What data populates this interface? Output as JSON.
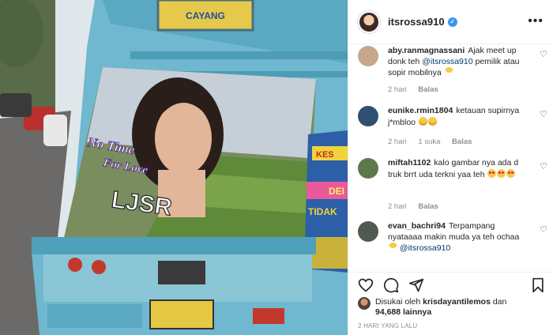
{
  "post": {
    "username": "itsrossa910",
    "verified_glyph": "✓",
    "more_glyph": "•••"
  },
  "image_text": {
    "plate_top": "CAYANG",
    "sticker_line1": "No Time",
    "sticker_line2": "For Love",
    "sticker_name": "LJSR",
    "side_sign1": "KES",
    "side_sign2": "DEI",
    "side_sign3": "TIDAK"
  },
  "comments": [
    {
      "user": "aby.ranmagnassani",
      "text_before": "Ajak meet up donk teh ",
      "mention": "@itsrossa910",
      "text_after": " pemilik atau sopir mobilnya",
      "emoji": "grin",
      "time": "2 hari",
      "likes": "",
      "reply": "Balas",
      "avatar_color": "#c7a78c"
    },
    {
      "user": "eunike.rmin1804",
      "text_before": "ketauan supirnya j*mbloo",
      "mention": "",
      "text_after": "",
      "emoji": "laugh",
      "time": "2 hari",
      "likes": "1 suka",
      "reply": "Balas",
      "avatar_color": "#2f4f6f"
    },
    {
      "user": "miftah1102",
      "text_before": "kalo gambar nya ada d truk brrt uda terkni yaa teh",
      "mention": "",
      "text_after": "",
      "emoji": "heart-eyes",
      "time": "2 hari",
      "likes": "",
      "reply": "Balas",
      "avatar_color": "#5b7a4a"
    },
    {
      "user": "evan_bachri94",
      "text_before": "Terpampang nyataaaa makin muda ya teh ochaa ",
      "mention": "@itsrossa910",
      "text_after": "",
      "emoji": "grin",
      "time": "2 hari",
      "likes": "",
      "reply": "Balas",
      "avatar_color": "#4f5a52"
    }
  ],
  "likes": {
    "prefix": "Disukai oleh ",
    "user": "krisdayantilemos",
    "middle": " dan ",
    "count": "94,688",
    "suffix": " lainnya"
  },
  "timestamp": "2 HARI YANG LALU",
  "icons": {
    "heart": "heart-icon",
    "comment": "comment-icon",
    "share": "share-icon",
    "save": "bookmark-icon"
  },
  "colors": {
    "mention": "#00376b",
    "verified": "#3897f0",
    "muted": "#8e8e8e"
  }
}
